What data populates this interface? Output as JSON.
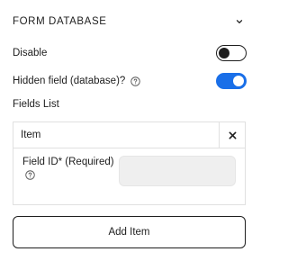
{
  "section": {
    "title": "FORM DATABASE",
    "collapse_icon": "chevron-down-icon"
  },
  "settings": {
    "disable": {
      "label": "Disable",
      "enabled": false
    },
    "hidden_field": {
      "label": "Hidden field (database)?",
      "help_icon": "question-circle-icon",
      "enabled": true
    }
  },
  "fields_list": {
    "label": "Fields List",
    "items": [
      {
        "title": "Item",
        "remove_icon": "close-icon",
        "field_id": {
          "label": "Field ID* (Required)",
          "help_icon": "question-circle-icon",
          "value": ""
        }
      }
    ],
    "add_button_label": "Add Item"
  },
  "colors": {
    "accent": "#1a6fe8",
    "text": "#1e1e1e",
    "border": "#e0e0e0",
    "input_bg": "#efefef"
  }
}
